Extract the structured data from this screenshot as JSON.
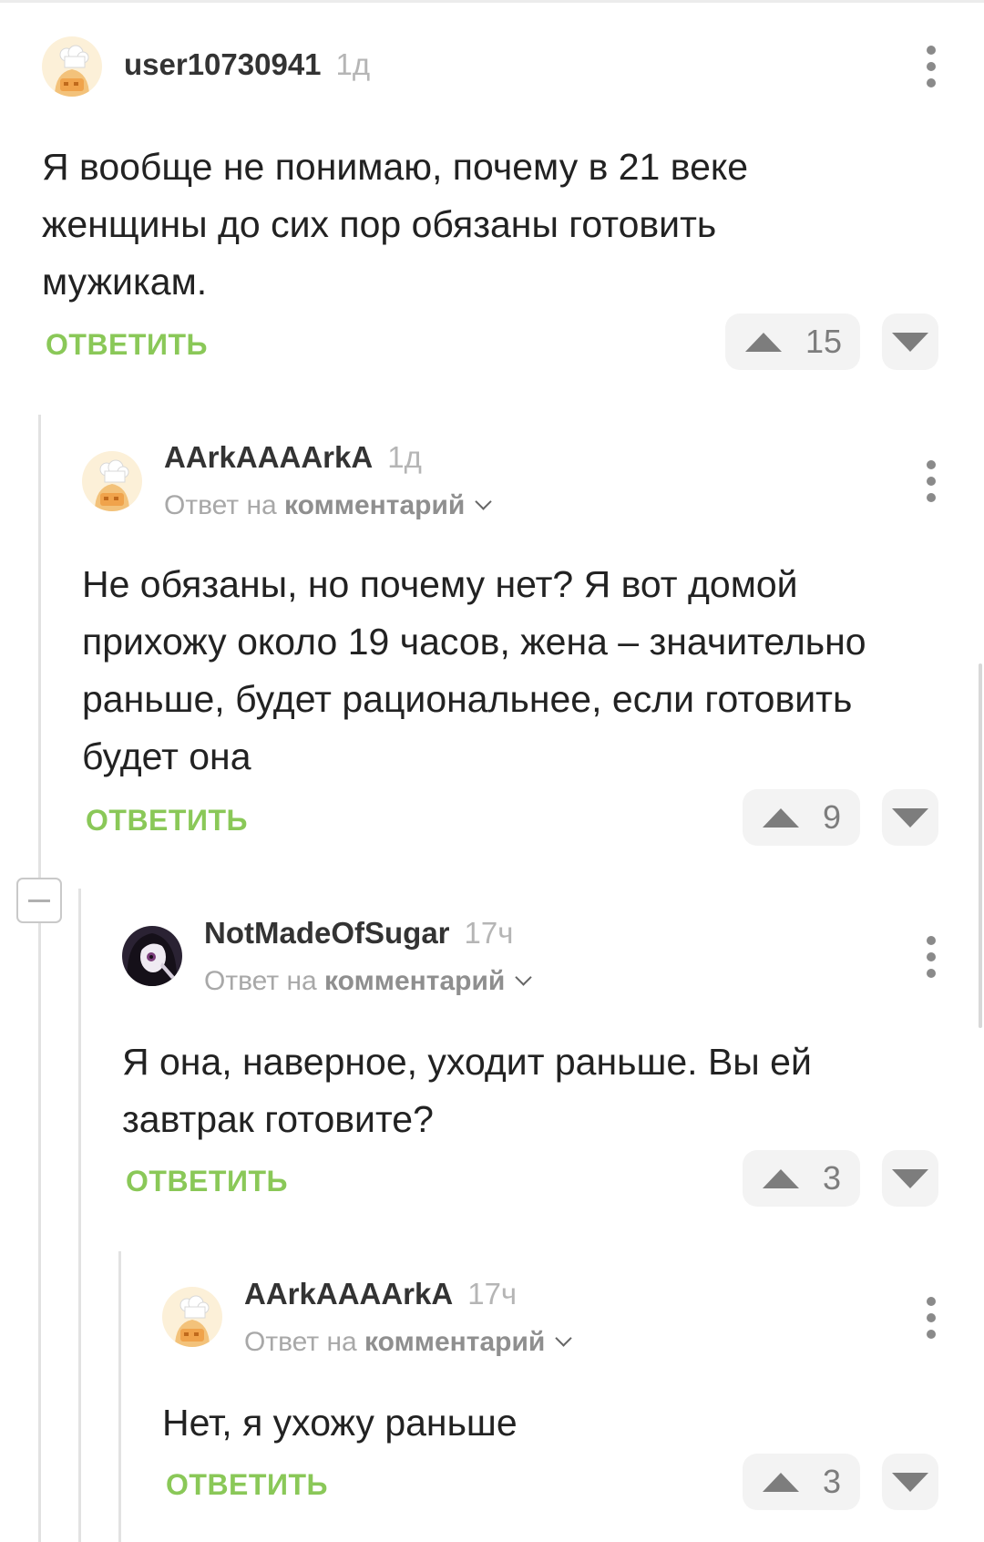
{
  "comments": [
    {
      "author": "user10730941",
      "time": "1д",
      "avatar": "chef-avatar-icon",
      "text": "Я вообще не понимаю, почему в 21 веке\nженщины до сих пор обязаны готовить\nмужикам.",
      "reply_label": "ОТВЕТИТЬ",
      "votes": "15"
    },
    {
      "author": "AArkAAAArkA",
      "time": "1д",
      "avatar": "chef-avatar-icon",
      "reply_to_prefix": "Ответ на",
      "reply_to_link": "комментарий",
      "text": "Не обязаны, но почему нет? Я вот домой\nприхожу около 19 часов, жена – значительно\nраньше, будет рациональнее, если готовить\nбудет она",
      "reply_label": "ОТВЕТИТЬ",
      "votes": "9"
    },
    {
      "author": "NotMadeOfSugar",
      "time": "17ч",
      "avatar": "dark-hair-avatar-icon",
      "reply_to_prefix": "Ответ на",
      "reply_to_link": "комментарий",
      "text": "Я она, наверное, уходит раньше. Вы ей\nзавтрак готовите?",
      "reply_label": "ОТВЕТИТЬ",
      "votes": "3"
    },
    {
      "author": "AArkAAAArkA",
      "time": "17ч",
      "avatar": "chef-avatar-icon",
      "reply_to_prefix": "Ответ на",
      "reply_to_link": "комментарий",
      "text": "Нет, я ухожу раньше",
      "reply_label": "ОТВЕТИТЬ",
      "votes": "3"
    }
  ],
  "colors": {
    "accent_green": "#8ac858",
    "text": "#222222",
    "muted": "#a8a8a8",
    "vote_bg": "#f3f3f3"
  }
}
